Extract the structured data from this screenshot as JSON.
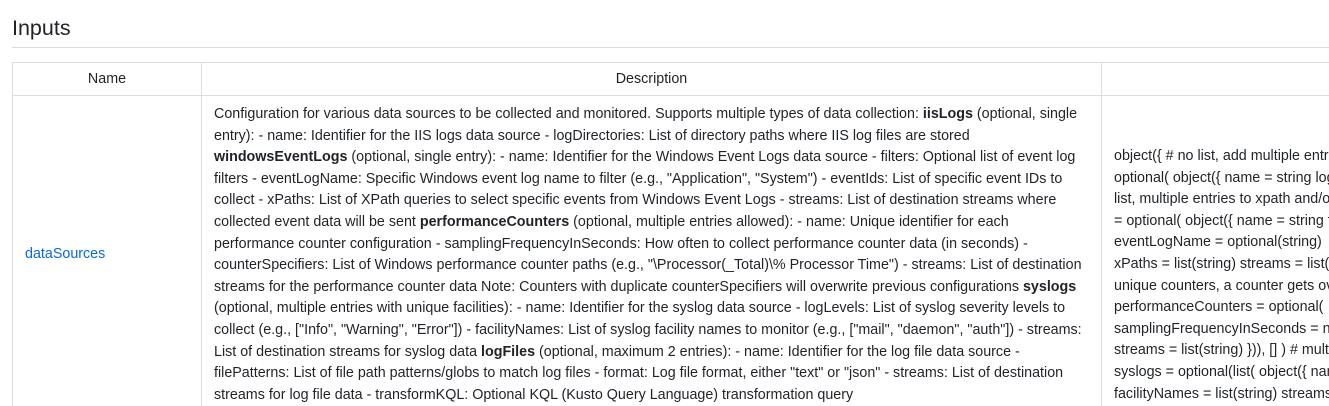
{
  "section": {
    "title": "Inputs"
  },
  "table": {
    "headers": {
      "name": "Name",
      "description": "Description",
      "type": ""
    },
    "rows": [
      {
        "name": "dataSources",
        "description_parts": [
          {
            "text": "Configuration for various data sources to be collected and monitored. Supports multiple types of data collection: ",
            "bold": false
          },
          {
            "text": "iisLogs",
            "bold": true
          },
          {
            "text": " (optional, single entry): - name: Identifier for the IIS logs data source - logDirectories: List of directory paths where IIS log files are stored ",
            "bold": false
          },
          {
            "text": "windowsEventLogs",
            "bold": true
          },
          {
            "text": " (optional, single entry): - name: Identifier for the Windows Event Logs data source - filters: Optional list of event log filters - eventLogName: Specific Windows event log name to filter (e.g., \"Application\", \"System\") - eventIds: List of specific event IDs to collect - xPaths: List of XPath queries to select specific events from Windows Event Logs - streams: List of destination streams where collected event data will be sent ",
            "bold": false
          },
          {
            "text": "performanceCounters",
            "bold": true
          },
          {
            "text": " (optional, multiple entries allowed): - name: Unique identifier for each performance counter configuration - samplingFrequencyInSeconds: How often to collect performance counter data (in seconds) - counterSpecifiers: List of Windows performance counter paths (e.g., \"\\Processor(_Total)\\% Processor Time\") - streams: List of destination streams for the performance counter data Note: Counters with duplicate counterSpecifiers will overwrite previous configurations ",
            "bold": false
          },
          {
            "text": "syslogs",
            "bold": true
          },
          {
            "text": " (optional, multiple entries with unique facilities): - name: Identifier for the syslog data source - logLevels: List of syslog severity levels to collect (e.g., [\"Info\", \"Warning\", \"Error\"]) - facilityNames: List of syslog facility names to monitor (e.g., [\"mail\", \"daemon\", \"auth\"]) - streams: List of destination streams for syslog data ",
            "bold": false
          },
          {
            "text": "logFiles",
            "bold": true
          },
          {
            "text": " (optional, maximum 2 entries): - name: Identifier for the log file data source - filePatterns: List of file path patterns/globs to match log files - format: Log file format, either \"text\" or \"json\" - streams: List of destination streams for log file data - transformKQL: Optional KQL (Kusto Query Language) transformation query",
            "bold": false
          }
        ],
        "type_lines": [
          "object({ # no list, add multiple entries",
          "optional( object({ name = string logDirectories",
          "list, multiple entries to xpath and/or",
          "= optional( object({ name = string filters",
          "eventLogName = optional(string)",
          "xPaths = list(string) streams = list(string)",
          "unique counters, a counter gets overwritten",
          "performanceCounters = optional(",
          "samplingFrequencyInSeconds = number",
          "streams = list(string) })), [] ) # multiple",
          "syslogs = optional(list( object({ name",
          "facilityNames = list(string) streams"
        ]
      }
    ]
  }
}
